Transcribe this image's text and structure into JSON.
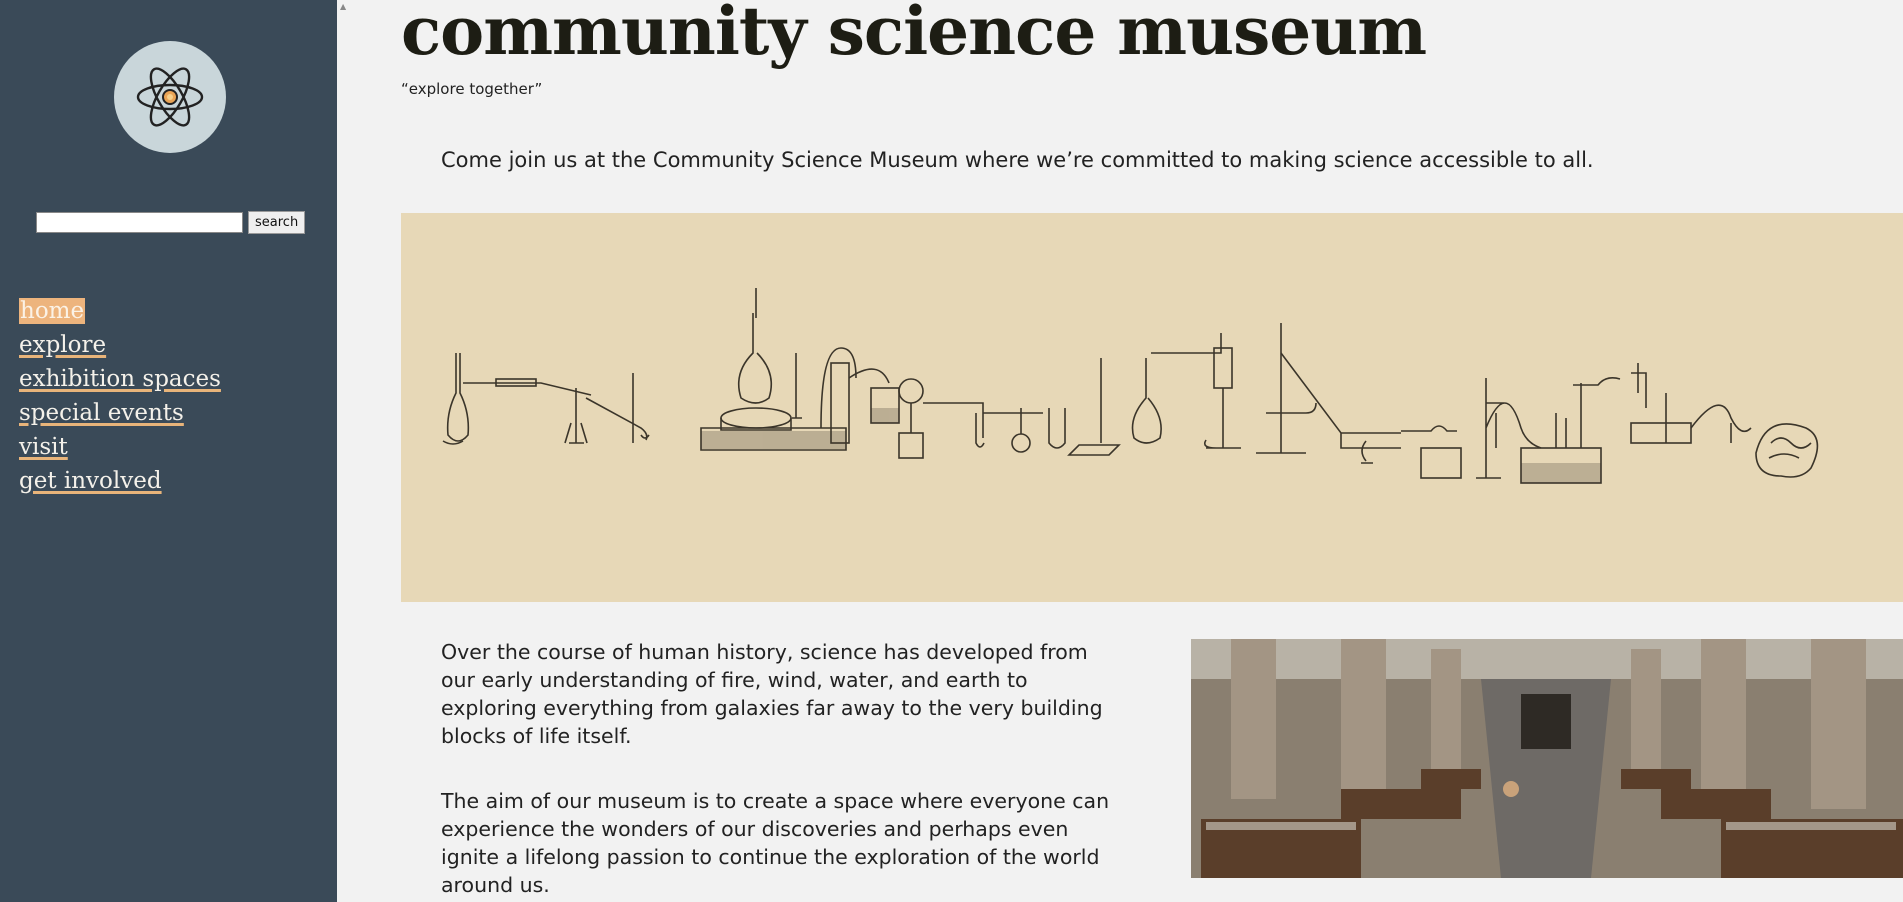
{
  "site": {
    "title": "community science museum",
    "tagline": "“explore together”"
  },
  "sidebar": {
    "logo_icon": "atom-icon",
    "search": {
      "placeholder": "",
      "value": "",
      "button_label": "search"
    },
    "nav": [
      {
        "label": "home",
        "active": true
      },
      {
        "label": "explore",
        "active": false
      },
      {
        "label": "exhibition spaces",
        "active": false
      },
      {
        "label": "special events",
        "active": false
      },
      {
        "label": "visit",
        "active": false
      },
      {
        "label": "get involved",
        "active": false
      }
    ]
  },
  "main": {
    "intro": "Come join us at the Community Science Museum where we’re committed to making science accessible to all.",
    "banner_icon": "lab-apparatus-illustration",
    "paragraphs": [
      "Over the course of human history, science has developed from our early understanding of fire, wind, water, and earth to exploring everything from galaxies far away to the very building blocks of life itself.",
      "The aim of our museum is to create a space where everyone can experience the wonders of our discoveries and perhaps even ignite a lifelong passion to continue the exploration of the world around us."
    ],
    "photo_icon": "museum-hall-photo"
  },
  "colors": {
    "sidebar_bg": "#3a4a58",
    "accent": "#edb47d",
    "banner_bg": "#e7d8b7",
    "page_bg": "#f2f2f2"
  }
}
